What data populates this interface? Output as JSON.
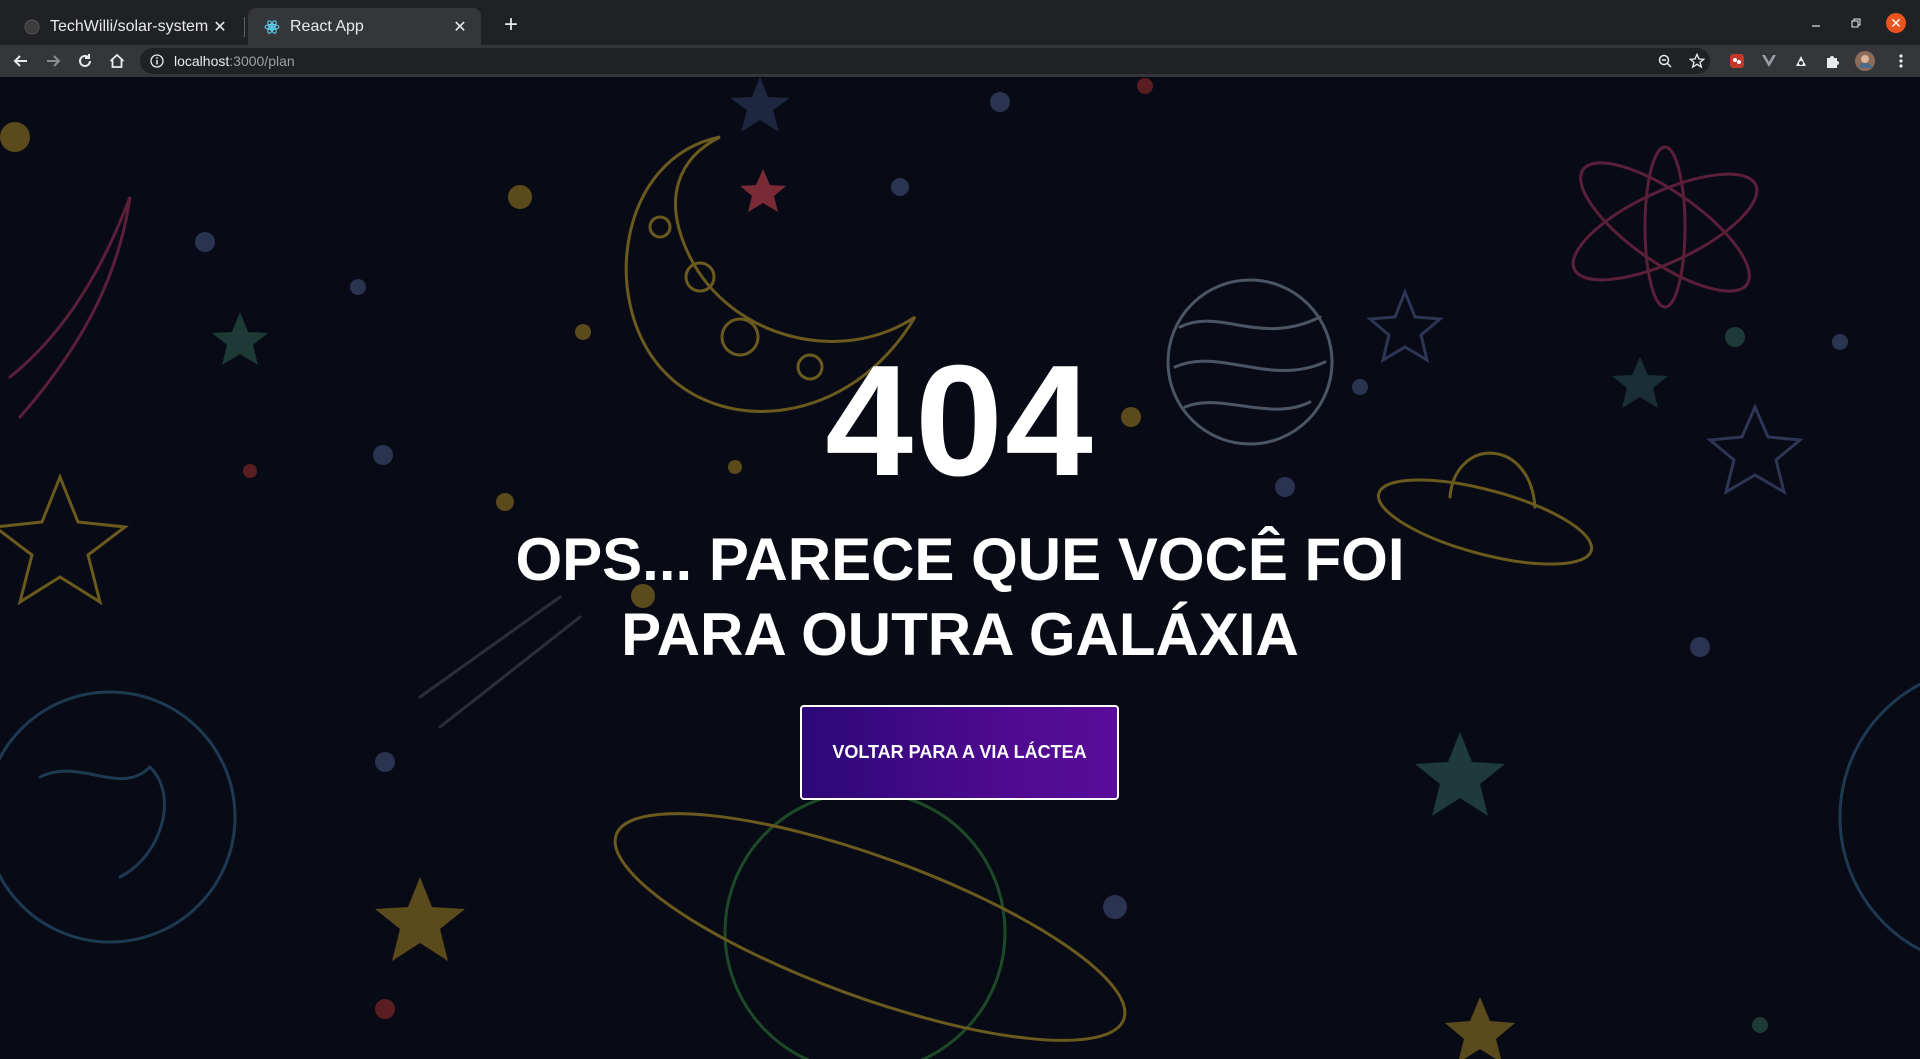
{
  "browser": {
    "tabs": [
      {
        "title": "TechWilli/solar-system",
        "favicon": "github-icon",
        "active": false
      },
      {
        "title": "React App",
        "favicon": "react-icon",
        "active": true
      }
    ],
    "url_host": "localhost",
    "url_path": ":3000/plan",
    "accent_close": "#e9541f"
  },
  "page": {
    "error_code": "404",
    "message_line1": "OPS... PARECE QUE VOCÊ FOI",
    "message_line2": "PARA OUTRA GALÁXIA",
    "button_label": "VOLTAR PARA A VIA LÁCTEA",
    "background_color": "#080b15",
    "button_gradient": [
      "#2c0877",
      "#5b0c9a"
    ]
  }
}
